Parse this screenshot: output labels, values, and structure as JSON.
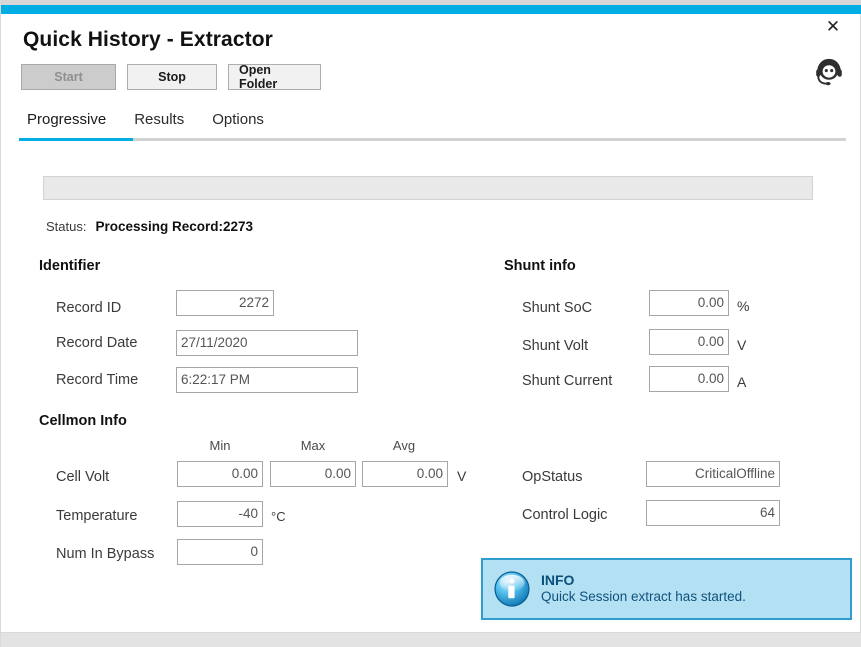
{
  "window": {
    "title": "Quick History - Extractor",
    "close_icon": "close-icon",
    "support_icon": "headset-support-icon",
    "accent_color": "#00aee4"
  },
  "toolbar": {
    "start_label": "Start",
    "stop_label": "Stop",
    "open_folder_label": "Open Folder"
  },
  "tabs": [
    {
      "label": "Progressive",
      "active": true
    },
    {
      "label": "Results",
      "active": false
    },
    {
      "label": "Options",
      "active": false
    }
  ],
  "progress": {
    "percent": "0"
  },
  "status": {
    "label": "Status:",
    "value": "Processing Record:2273"
  },
  "identifier": {
    "heading": "Identifier",
    "fields": [
      {
        "label": "Record ID",
        "value": "2272",
        "align": "right"
      },
      {
        "label": "Record Date",
        "value": "27/11/2020",
        "align": "left"
      },
      {
        "label": "Record Time",
        "value": "6:22:17 PM",
        "align": "left"
      }
    ]
  },
  "shunt": {
    "heading": "Shunt info",
    "fields": [
      {
        "label": "Shunt SoC",
        "value": "0.00",
        "unit": "%"
      },
      {
        "label": "Shunt Volt",
        "value": "0.00",
        "unit": "V"
      },
      {
        "label": "Shunt Current",
        "value": "0.00",
        "unit": "A"
      }
    ]
  },
  "cellmon": {
    "heading": "Cellmon Info",
    "columns": [
      "Min",
      "Max",
      "Avg"
    ],
    "cell_volt": {
      "label": "Cell Volt",
      "min": "0.00",
      "max": "0.00",
      "avg": "0.00",
      "unit": "V"
    },
    "temperature": {
      "label": "Temperature",
      "value": "-40",
      "unit": "°C"
    },
    "num_in_bypass": {
      "label": "Num In Bypass",
      "value": "0"
    }
  },
  "opinfo": {
    "op_status": {
      "label": "OpStatus",
      "value": "CriticalOffline"
    },
    "control_logic": {
      "label": "Control Logic",
      "value": "64"
    }
  },
  "info_banner": {
    "icon": "info-circle-icon",
    "title": "INFO",
    "message": "Quick Session extract has started.",
    "background": "#b3e0f2",
    "border": "#2e9ccc"
  }
}
